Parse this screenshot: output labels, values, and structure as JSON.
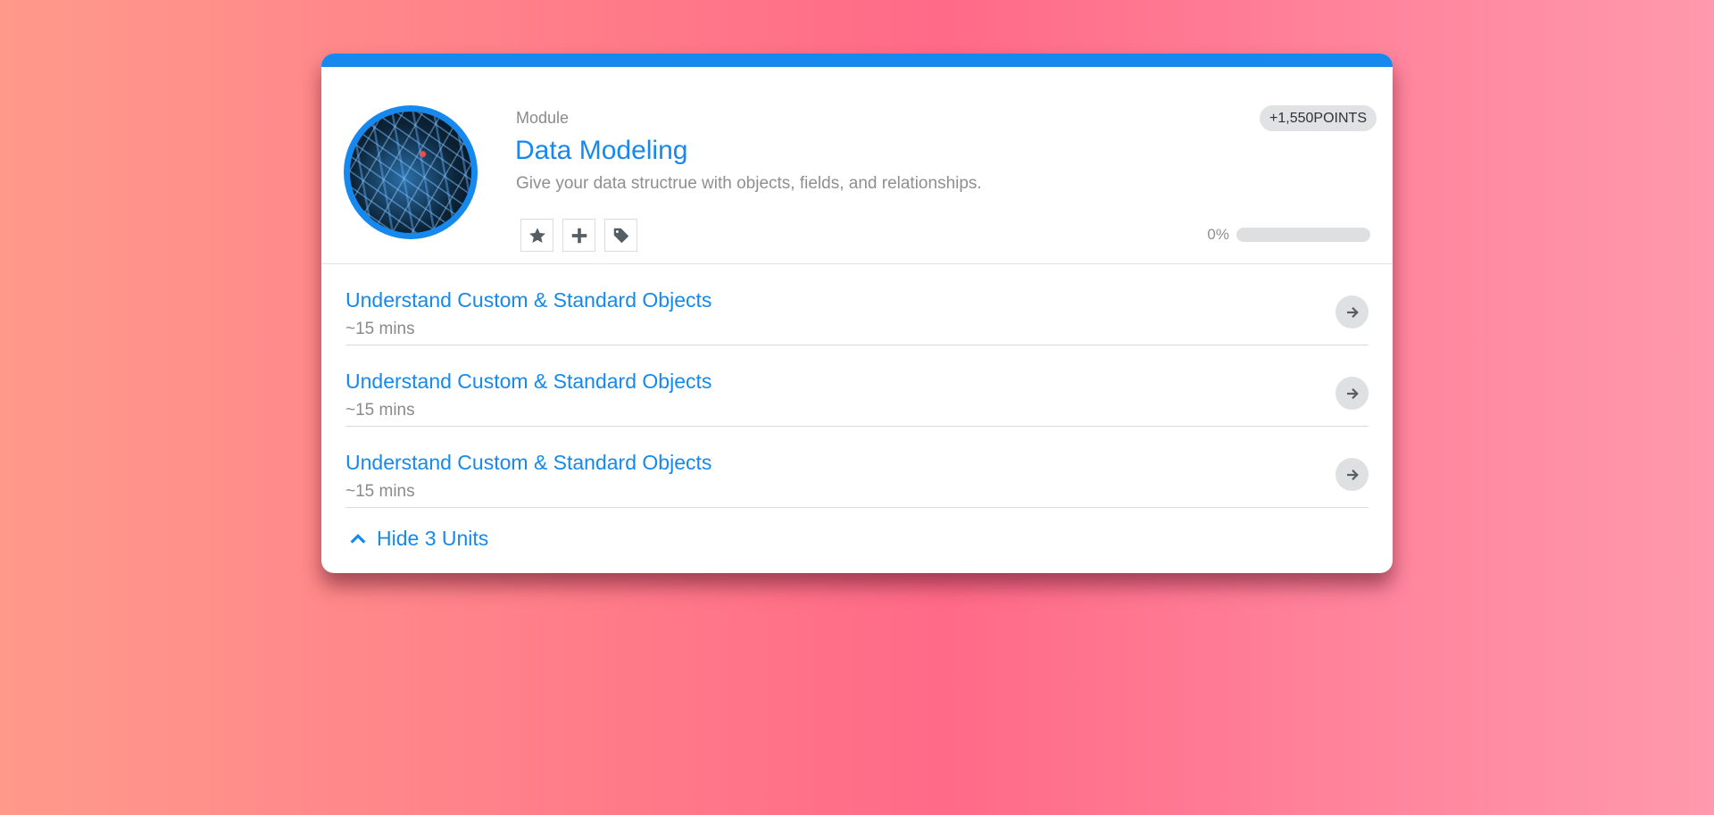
{
  "card": {
    "eyebrow": "Module",
    "title": "Data Modeling",
    "description": "Give your data structrue with objects, fields, and relationships.",
    "points_badge": "+1,550POINTS",
    "progress": {
      "label": "0%",
      "value_percent": 0
    },
    "actions": [
      {
        "name": "favorite",
        "icon": "star-icon"
      },
      {
        "name": "add",
        "icon": "plus-icon"
      },
      {
        "name": "tag",
        "icon": "tag-icon"
      }
    ],
    "accent_color": "#1589ee"
  },
  "units": [
    {
      "title": "Understand Custom & Standard Objects",
      "duration": "~15 mins",
      "icon": "arrow-right-icon"
    },
    {
      "title": "Understand Custom & Standard Objects",
      "duration": "~15 mins",
      "icon": "arrow-right-icon"
    },
    {
      "title": "Understand Custom & Standard Objects",
      "duration": "~15 mins",
      "icon": "arrow-right-icon"
    }
  ],
  "toggle": {
    "label": "Hide 3 Units",
    "icon": "chevron-up-icon"
  }
}
